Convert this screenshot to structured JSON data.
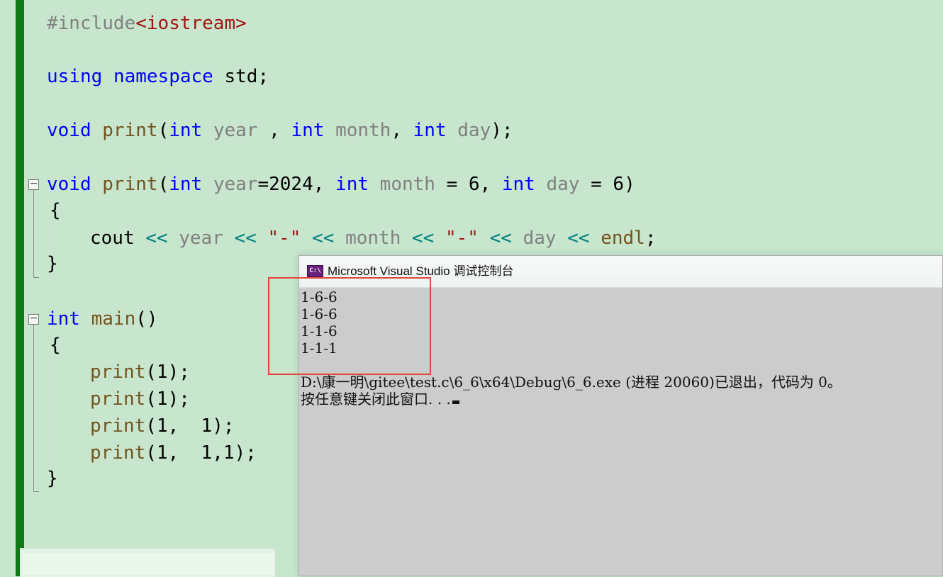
{
  "editor": {
    "include": {
      "directive": "#include",
      "header": "<iostream>"
    },
    "using": {
      "kw1": "using",
      "kw2": "namespace",
      "name": "std",
      "end": ";"
    },
    "decl": {
      "ret": "void",
      "fn": "print",
      "open": "(",
      "t1": "int",
      "p1": "year",
      "sep1": " , ",
      "t2": "int",
      "p2": "month",
      "sep2": ", ",
      "t3": "int",
      "p3": "day",
      "end": ");"
    },
    "def": {
      "ret": "void",
      "fn": "print",
      "open": "(",
      "t1": "int",
      "p1": "year",
      "d1": "=2024, ",
      "t2": "int",
      "p2": "month",
      "d2": " = 6, ",
      "t3": "int",
      "p3": "day",
      "d3": " = 6)"
    },
    "brace_open": "{",
    "brace_close": "}",
    "cout_line": {
      "cout": "cout",
      "op1": "<<",
      "year": "year",
      "op2": "<<",
      "s1": "\"-\"",
      "op3": "<<",
      "month": "month",
      "op4": "<<",
      "s2": "\"-\"",
      "op5": "<<",
      "day": "day",
      "op6": "<<",
      "endl": "endl",
      "end": ";"
    },
    "main": {
      "t": "int",
      "fn": "main",
      "rest": "()"
    },
    "calls": [
      {
        "fn": "print",
        "args": "(1);"
      },
      {
        "fn": "print",
        "args": "(1);"
      },
      {
        "fn": "print",
        "args": "(1,  1);"
      },
      {
        "fn": "print",
        "args": "(1,  1,1);"
      }
    ],
    "fold_minus": "−"
  },
  "console": {
    "icon_text": "C:\\",
    "title": "Microsoft Visual Studio 调试控制台",
    "output": [
      "1-6-6",
      "1-6-6",
      "1-1-6",
      "1-1-1"
    ],
    "exit_message": "D:\\康一明\\gitee\\test.c\\6_6\\x64\\Debug\\6_6.exe (进程 20060)已退出，代码为 0。",
    "prompt": "按任意键关闭此窗口. . ."
  },
  "colors": {
    "editor_background": "#c7e6cd",
    "change_bar": "#0f7a17",
    "keyword": "#0000ff",
    "function": "#74531f",
    "string": "#a31515",
    "operator": "#008080",
    "console_background": "#cccccc",
    "highlight_box": "#e5443a"
  }
}
